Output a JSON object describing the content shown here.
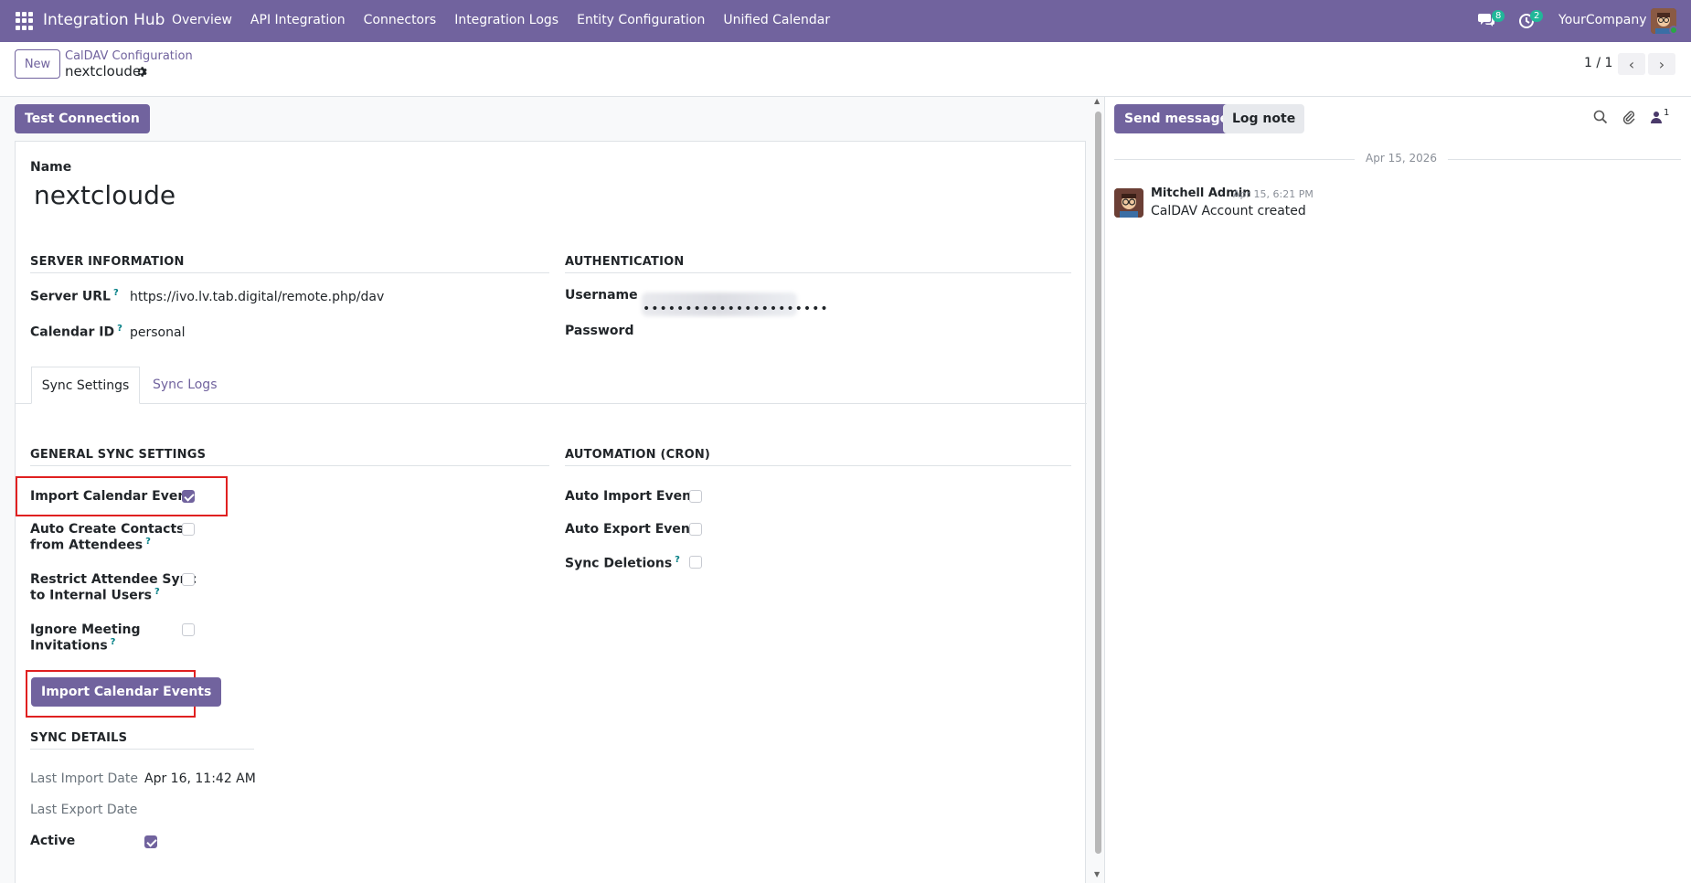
{
  "navbar": {
    "brand": "Integration Hub",
    "menu": [
      "Overview",
      "API Integration",
      "Connectors",
      "Integration Logs",
      "Entity Configuration",
      "Unified Calendar"
    ],
    "messages_count": "8",
    "activities_count": "2",
    "company": "YourCompany",
    "bg_color": "#71639e"
  },
  "control": {
    "new_label": "New",
    "breadcrumb_parent": "CalDAV Configuration",
    "breadcrumb_current": "nextcloude",
    "pager": "1 / 1"
  },
  "form": {
    "test_connection_label": "Test Connection",
    "name_label": "Name",
    "name_value": "nextcloude",
    "server_section": "SERVER INFORMATION",
    "server_url_label": "Server URL",
    "server_url_value": "https://ivo.lv.tab.digital/remote.php/dav",
    "calendar_id_label": "Calendar ID",
    "calendar_id_value": "personal",
    "auth_section": "AUTHENTICATION",
    "username_label": "Username",
    "password_label": "Password",
    "password_value": "••••••••••••••••••••••",
    "tabs": [
      "Sync Settings",
      "Sync Logs"
    ],
    "general_section": "GENERAL SYNC SETTINGS",
    "import_calendar_event_label": "Import Calendar Event",
    "import_calendar_event_checked": true,
    "auto_create_contacts_label_1": "Auto Create Contacts",
    "auto_create_contacts_label_2": "from Attendees",
    "auto_create_contacts_checked": false,
    "restrict_sync_label_1": "Restrict Attendee Sync",
    "restrict_sync_label_2": "to Internal Users",
    "restrict_sync_checked": false,
    "ignore_invites_label_1": "Ignore Meeting",
    "ignore_invites_label_2": "Invitations",
    "ignore_invites_checked": false,
    "import_events_button": "Import Calendar Events",
    "automation_section": "AUTOMATION (CRON)",
    "auto_import_label": "Auto Import Event",
    "auto_import_checked": false,
    "auto_export_label": "Auto Export Event",
    "auto_export_checked": false,
    "sync_deletions_label": "Sync Deletions",
    "sync_deletions_checked": false,
    "sync_details_section": "SYNC DETAILS",
    "last_import_label": "Last Import Date",
    "last_import_value": "Apr 16, 11:42 AM",
    "last_export_label": "Last Export Date",
    "last_export_value": "",
    "active_label": "Active",
    "active_checked": true,
    "help_mark": "?"
  },
  "chatter": {
    "send_message_label": "Send message",
    "log_note_label": "Log note",
    "followers_count": "1",
    "date_separator": "Apr 15, 2026",
    "message": {
      "author": "Mitchell Admin",
      "time": "Apr 15, 6:21 PM",
      "body": "CalDAV Account created"
    }
  }
}
